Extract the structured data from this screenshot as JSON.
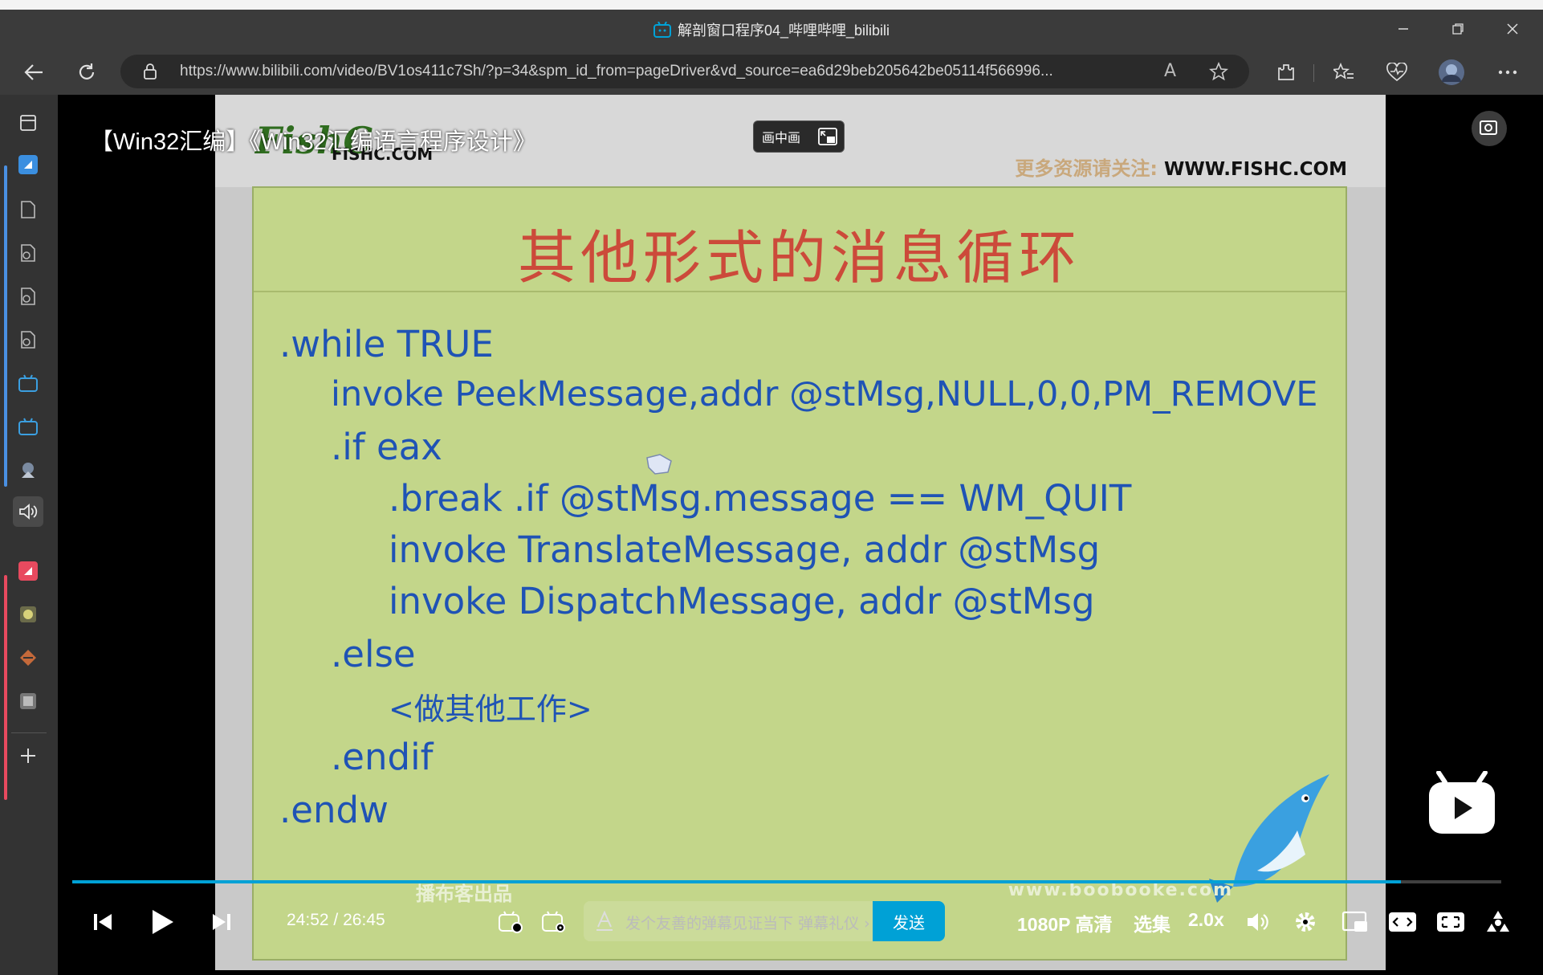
{
  "browser": {
    "tab_title": "解剖窗口程序04_哔哩哔哩_bilibili",
    "url": "https://www.bilibili.com/video/BV1os411c7Sh/?p=34&spm_id_from=pageDriver&vd_source=ea6d29beb205642be05114f566996...",
    "read_aloud_label": "A"
  },
  "player": {
    "video_title": "【Win32汇编】《Win32汇编语言程序设计》",
    "pip_label": "画中画",
    "time_current": "24:52",
    "time_separator": "/",
    "time_total": "26:45",
    "progress": 0.93,
    "danmaku_placeholder": "发个友善的弹幕见证当下",
    "danmaku_etiquette": "弹幕礼仪 ›",
    "send_label": "发送",
    "quality_label": "1080P 高清",
    "episodes_label": "选集",
    "speed_label": "2.0x"
  },
  "slide": {
    "logo_text": "FishC",
    "logo_sub": "FISHC.COM",
    "more_resources_cn": "更多资源请关注:",
    "more_resources_url": "WWW.FISHC.COM",
    "heading": "其他形式的消息循环",
    "code_lines": [
      ".while TRUE",
      "invoke  PeekMessage,addr @stMsg,NULL,0,0,PM_REMOVE",
      ".if eax",
      ".break .if @stMsg.message == WM_QUIT",
      "invoke  TranslateMessage, addr @stMsg",
      "invoke  DispatchMessage, addr @stMsg",
      ".else",
      "<做其他工作>",
      ".endif",
      ".endw"
    ],
    "watermark_cn": "播布客出品",
    "watermark_url": "www.boobooke.com"
  },
  "colors": {
    "accent": "#00a1d6",
    "board_bg": "#c3d68a",
    "code_text": "#1f53b5",
    "heading_text": "#cc4a3a"
  }
}
